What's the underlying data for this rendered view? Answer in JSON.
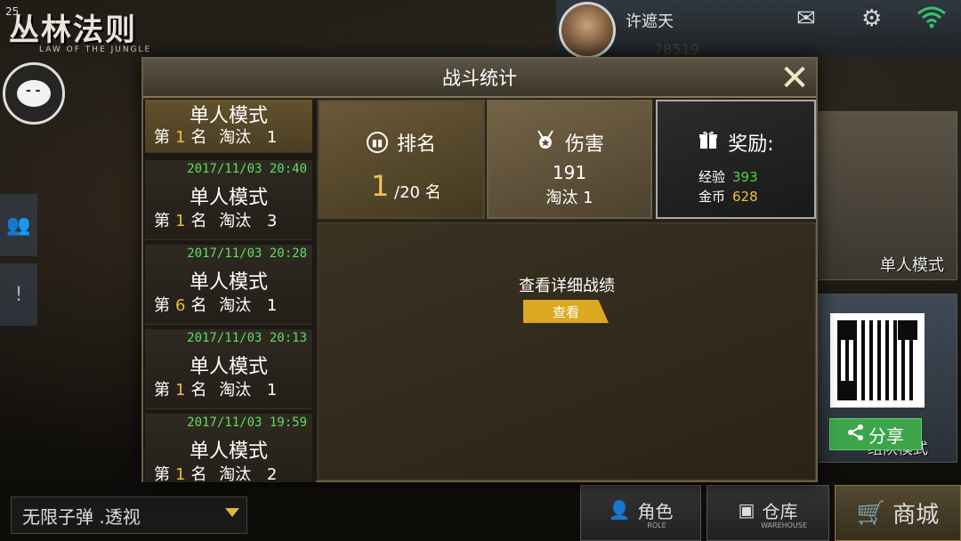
{
  "status": {
    "fps": "25"
  },
  "logo": {
    "title": "丛林法则",
    "subtitle": "LAW OF THE JUNGLE"
  },
  "player": {
    "name": "许遮天",
    "currency": "78519"
  },
  "icons": {
    "mail": "mail-icon",
    "settings": "gear-icon",
    "wifi": "wifi-icon"
  },
  "dialog": {
    "title": "战斗统计",
    "close": "✕",
    "history": [
      {
        "date": "",
        "mode": "单人模式",
        "prefix": "第",
        "rank": "1",
        "rank_suffix": "名",
        "kill_label": "淘汰",
        "kills": "1"
      },
      {
        "date": "2017/11/03 20:40",
        "mode": "单人模式",
        "prefix": "第",
        "rank": "1",
        "rank_suffix": "名",
        "kill_label": "淘汰",
        "kills": "3"
      },
      {
        "date": "2017/11/03 20:28",
        "mode": "单人模式",
        "prefix": "第",
        "rank": "6",
        "rank_suffix": "名",
        "kill_label": "淘汰",
        "kills": "1"
      },
      {
        "date": "2017/11/03 20:13",
        "mode": "单人模式",
        "prefix": "第",
        "rank": "1",
        "rank_suffix": "名",
        "kill_label": "淘汰",
        "kills": "1"
      },
      {
        "date": "2017/11/03 19:59",
        "mode": "单人模式",
        "prefix": "第",
        "rank": "1",
        "rank_suffix": "名",
        "kill_label": "淘汰",
        "kills": "2"
      }
    ],
    "rank_panel": {
      "label": "排名",
      "value": "1",
      "total": "/20 名"
    },
    "damage_panel": {
      "label": "伤害",
      "value": "191",
      "kills_line": "淘汰  1"
    },
    "reward_panel": {
      "label": "奖励:",
      "exp_label": "经验",
      "exp_value": "393",
      "gold_label": "金币",
      "gold_value": "628"
    },
    "detail": {
      "text": "查看详细战绩",
      "button": "查看"
    }
  },
  "right": {
    "solo_label": "单人模式",
    "team_label": "组队模式",
    "share_label": "分享"
  },
  "bottom": {
    "cheat_select": "无限子弹 .透视",
    "role": {
      "label": "角色",
      "sub": "ROLE"
    },
    "warehouse": {
      "label": "仓库",
      "sub": "WAREHOUSE"
    },
    "shop": {
      "label": "商城"
    }
  },
  "colors": {
    "accent": "#dba920",
    "rank_highlight": "#f0b93a",
    "date_green": "#5fde5f",
    "exp_green": "#46d846",
    "gold": "#f0c040",
    "share_green": "#3ca54a"
  }
}
